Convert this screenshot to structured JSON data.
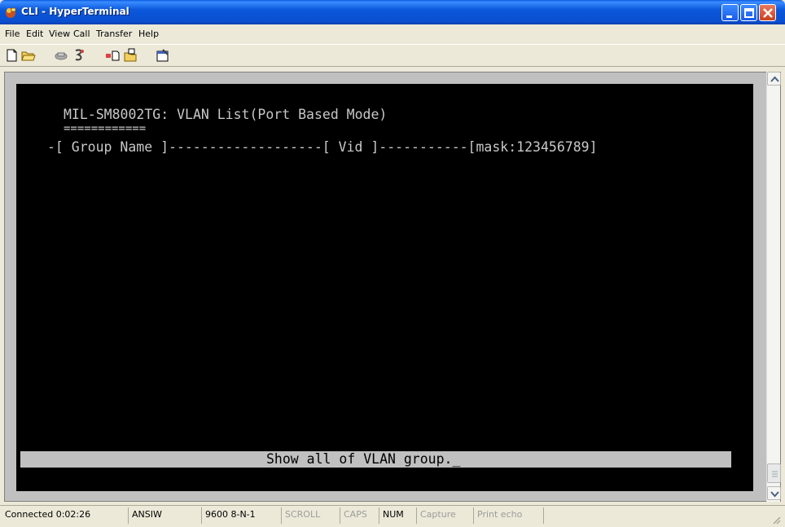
{
  "window": {
    "title": "CLI - HyperTerminal"
  },
  "menu": [
    {
      "label": "File",
      "key": "F"
    },
    {
      "label": "Edit",
      "key": "E"
    },
    {
      "label": "View",
      "key": "V"
    },
    {
      "label": "Call",
      "key": "C"
    },
    {
      "label": "Transfer",
      "key": "T"
    },
    {
      "label": "Help",
      "key": "H"
    }
  ],
  "toolbar": {
    "icons": [
      "new-connection-icon",
      "open-icon",
      "disconnect-icon",
      "dial-icon",
      "send-icon",
      "receive-icon",
      "properties-icon"
    ]
  },
  "terminal": {
    "title_line": "MIL-SM8002TG: VLAN List(Port Based Mode)",
    "title_underline": "============",
    "header_line": "-[ Group Name ]-------------------[ Vid ]-----------[mask:123456789]",
    "status_message": "Show all of VLAN group.",
    "cursor": "_"
  },
  "statusbar": {
    "connected": "Connected 0:02:26",
    "emulation": "ANSIW",
    "port_settings": "9600 8-N-1",
    "scroll": "SCROLL",
    "caps": "CAPS",
    "num": "NUM",
    "capture": "Capture",
    "print_echo": "Print echo"
  },
  "colors": {
    "terminal_bg": "#000000",
    "terminal_fg": "#c8c8c8",
    "titlebar": "#0a58db",
    "close_button": "#c9401f"
  }
}
